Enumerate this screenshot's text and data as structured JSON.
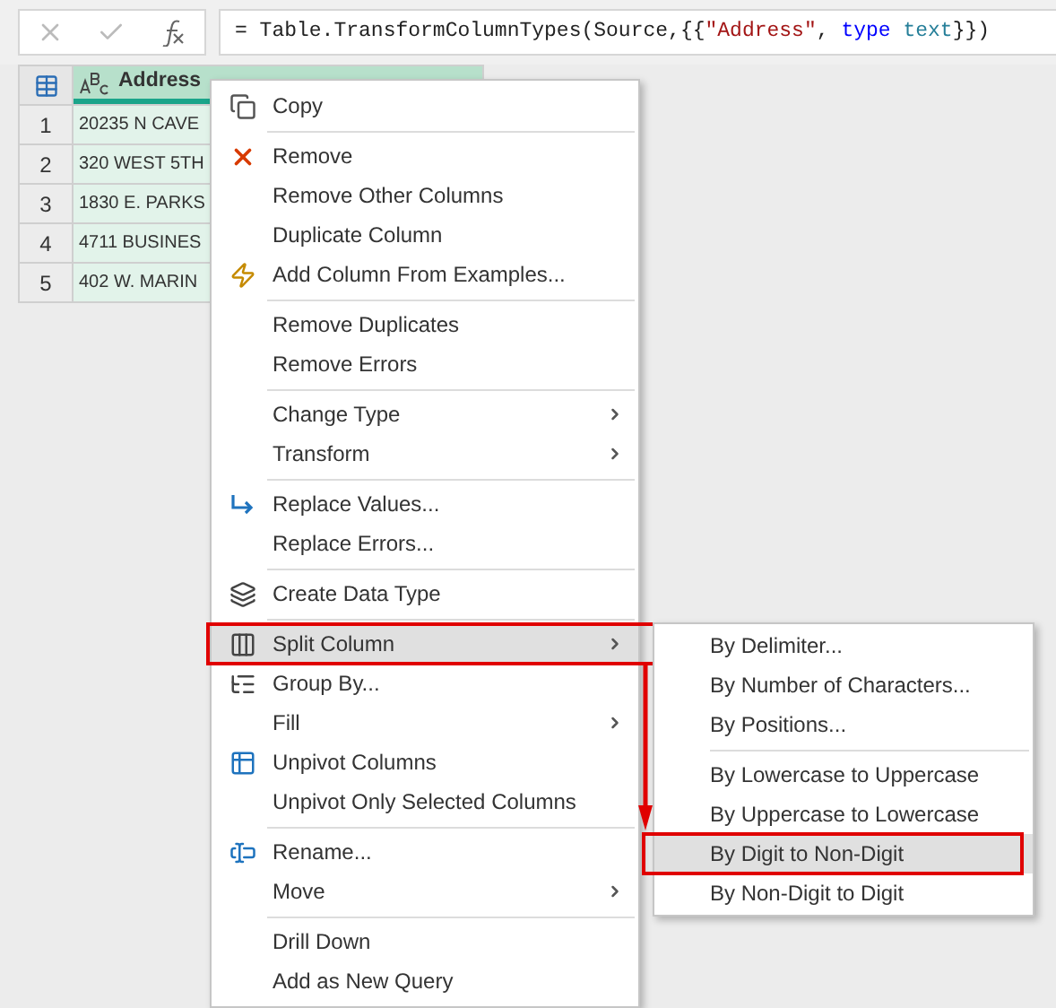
{
  "formula_bar": {
    "tokens": [
      {
        "text": "= Table.TransformColumnTypes(Source,{{",
        "kind": "plain"
      },
      {
        "text": "\"Address\"",
        "kind": "string"
      },
      {
        "text": ", ",
        "kind": "plain"
      },
      {
        "text": "type",
        "kind": "keyword"
      },
      {
        "text": " text",
        "kind": "type"
      },
      {
        "text": "}})",
        "kind": "plain"
      }
    ]
  },
  "table": {
    "columns": [
      "Address"
    ],
    "rows": [
      {
        "number": "1",
        "cell": "20235 N CAVE"
      },
      {
        "number": "2",
        "cell": "320 WEST 5TH"
      },
      {
        "number": "3",
        "cell": "1830 E. PARKS"
      },
      {
        "number": "4",
        "cell": "4711 BUSINES"
      },
      {
        "number": "5",
        "cell": "402 W. MARIN"
      }
    ]
  },
  "context_menu": {
    "groups": [
      {
        "items": [
          {
            "label": "Copy",
            "has_submenu": false,
            "selected": false
          }
        ]
      },
      {
        "items": [
          {
            "label": "Remove",
            "has_submenu": false,
            "selected": false
          },
          {
            "label": "Remove Other Columns",
            "has_submenu": false,
            "selected": false
          },
          {
            "label": "Duplicate Column",
            "has_submenu": false,
            "selected": false
          },
          {
            "label": "Add Column From Examples...",
            "has_submenu": false,
            "selected": false
          }
        ]
      },
      {
        "items": [
          {
            "label": "Remove Duplicates",
            "has_submenu": false,
            "selected": false
          },
          {
            "label": "Remove Errors",
            "has_submenu": false,
            "selected": false
          }
        ]
      },
      {
        "items": [
          {
            "label": "Change Type",
            "has_submenu": true,
            "selected": false
          },
          {
            "label": "Transform",
            "has_submenu": true,
            "selected": false
          }
        ]
      },
      {
        "items": [
          {
            "label": "Replace Values...",
            "has_submenu": false,
            "selected": false
          },
          {
            "label": "Replace Errors...",
            "has_submenu": false,
            "selected": false
          }
        ]
      },
      {
        "items": [
          {
            "label": "Create Data Type",
            "has_submenu": false,
            "selected": false
          }
        ]
      },
      {
        "items": [
          {
            "label": "Split Column",
            "has_submenu": true,
            "selected": true
          },
          {
            "label": "Group By...",
            "has_submenu": false,
            "selected": false
          },
          {
            "label": "Fill",
            "has_submenu": true,
            "selected": false
          },
          {
            "label": "Unpivot Columns",
            "has_submenu": false,
            "selected": false
          },
          {
            "label": "Unpivot Only Selected Columns",
            "has_submenu": false,
            "selected": false
          }
        ]
      },
      {
        "items": [
          {
            "label": "Rename...",
            "has_submenu": false,
            "selected": false
          },
          {
            "label": "Move",
            "has_submenu": true,
            "selected": false
          }
        ]
      },
      {
        "items": [
          {
            "label": "Drill Down",
            "has_submenu": false,
            "selected": false
          },
          {
            "label": "Add as New Query",
            "has_submenu": false,
            "selected": false
          }
        ]
      }
    ]
  },
  "submenu": {
    "groups": [
      {
        "items": [
          {
            "label": "By Delimiter...",
            "selected": false
          },
          {
            "label": "By Number of Characters...",
            "selected": false
          },
          {
            "label": "By Positions...",
            "selected": false
          }
        ]
      },
      {
        "items": [
          {
            "label": "By Lowercase to Uppercase",
            "selected": false
          },
          {
            "label": "By Uppercase to Lowercase",
            "selected": false
          },
          {
            "label": "By Digit to Non-Digit",
            "selected": true
          },
          {
            "label": "By Non-Digit to Digit",
            "selected": false
          }
        ]
      }
    ]
  }
}
